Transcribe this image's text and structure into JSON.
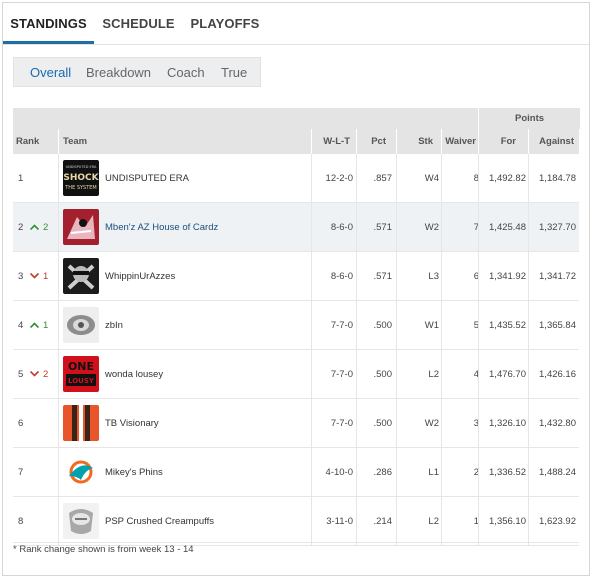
{
  "tabs": [
    {
      "label": "STANDINGS",
      "active": true
    },
    {
      "label": "SCHEDULE",
      "active": false
    },
    {
      "label": "PLAYOFFS",
      "active": false
    }
  ],
  "subtabs": [
    {
      "label": "Overall",
      "active": true
    },
    {
      "label": "Breakdown",
      "active": false
    },
    {
      "label": "Coach",
      "active": false
    },
    {
      "label": "True",
      "active": false
    }
  ],
  "table": {
    "points_group": "Points",
    "headers": {
      "rank": "Rank",
      "team": "Team",
      "wlt": "W-L-T",
      "pct": "Pct",
      "stk": "Stk",
      "waiver": "Waiver",
      "for": "For",
      "against": "Against"
    },
    "rows": [
      {
        "rank": "1",
        "move": "",
        "move_dir": "",
        "team": "UNDISPUTED ERA",
        "logo": "shock-the-system-logo",
        "wlt": "12-2-0",
        "pct": ".857",
        "stk": "W4",
        "waiver": "8",
        "for": "1,492.82",
        "against": "1,184.78"
      },
      {
        "rank": "2",
        "move": "2",
        "move_dir": "up",
        "team": "Mben'z AZ House of Cardz",
        "logo": "cardinals-logo",
        "wlt": "8-6-0",
        "pct": ".571",
        "stk": "W2",
        "waiver": "7",
        "for": "1,425.48",
        "against": "1,327.70"
      },
      {
        "rank": "3",
        "move": "1",
        "move_dir": "down",
        "team": "WhippinUrAzzes",
        "logo": "raiders-logo",
        "wlt": "8-6-0",
        "pct": ".571",
        "stk": "L3",
        "waiver": "6",
        "for": "1,341.92",
        "against": "1,341.72"
      },
      {
        "rank": "4",
        "move": "1",
        "move_dir": "up",
        "team": "zbIn",
        "logo": "ring-logo",
        "wlt": "7-7-0",
        "pct": ".500",
        "stk": "W1",
        "waiver": "5",
        "for": "1,435.52",
        "against": "1,365.84"
      },
      {
        "rank": "5",
        "move": "2",
        "move_dir": "down",
        "team": "wonda lousey",
        "logo": "red-text-logo",
        "wlt": "7-7-0",
        "pct": ".500",
        "stk": "L2",
        "waiver": "4",
        "for": "1,476.70",
        "against": "1,426.16"
      },
      {
        "rank": "6",
        "move": "",
        "move_dir": "",
        "team": "TB Visionary",
        "logo": "browns-stripes-logo",
        "wlt": "7-7-0",
        "pct": ".500",
        "stk": "W2",
        "waiver": "3",
        "for": "1,326.10",
        "against": "1,432.80"
      },
      {
        "rank": "7",
        "move": "",
        "move_dir": "",
        "team": "Mikey's Phins",
        "logo": "dolphins-logo",
        "wlt": "4-10-0",
        "pct": ".286",
        "stk": "L1",
        "waiver": "2",
        "for": "1,336.52",
        "against": "1,488.24"
      },
      {
        "rank": "8",
        "move": "",
        "move_dir": "",
        "team": "PSP Crushed Creampuffs",
        "logo": "championship-ring-logo",
        "wlt": "3-11-0",
        "pct": ".214",
        "stk": "L2",
        "waiver": "1",
        "for": "1,356.10",
        "against": "1,623.92"
      }
    ]
  },
  "footnote": "* Rank change shown is from week 13 - 14",
  "colors": {
    "accent": "#1c6ea4",
    "up": "#2f8f2f",
    "down": "#c0392b"
  }
}
